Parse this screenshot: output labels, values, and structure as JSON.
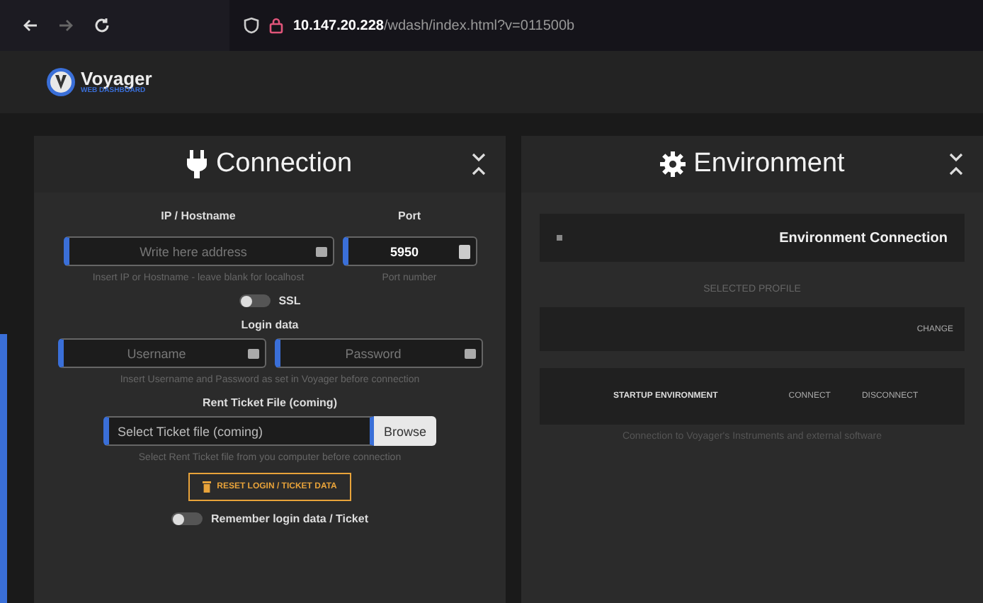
{
  "browser": {
    "url_host": "10.147.20.228",
    "url_path": "/wdash/index.html?v=011500b"
  },
  "app": {
    "name": "Voyager",
    "subtitle": "WEB DASHBOARD"
  },
  "connection": {
    "title": "Connection",
    "host": {
      "label": "IP / Hostname",
      "placeholder": "Write here address",
      "hint": "Insert IP or Hostname - leave blank for localhost"
    },
    "port": {
      "label": "Port",
      "value": "5950",
      "hint": "Port number"
    },
    "ssl": {
      "label": "SSL",
      "on": false
    },
    "login_label": "Login data",
    "username": {
      "placeholder": "Username"
    },
    "password": {
      "placeholder": "Password"
    },
    "login_hint": "Insert Username and Password as set in Voyager before connection",
    "ticket_label": "Rent Ticket File (coming)",
    "ticket": {
      "placeholder": "Select Ticket file (coming)",
      "button": "Browse",
      "hint": "Select Rent Ticket file from you computer before connection"
    },
    "reset_button": "RESET LOGIN / TICKET DATA",
    "remember": {
      "label": "Remember login data / Ticket",
      "on": false
    }
  },
  "environment": {
    "title": "Environment",
    "connection_title": "Environment Connection",
    "profile_label": "SELECTED PROFILE",
    "change": "CHANGE",
    "startup": "STARTUP ENVIRONMENT",
    "connect": "CONNECT",
    "disconnect": "DISCONNECT",
    "hint": "Connection to Voyager's Instruments and external software"
  }
}
